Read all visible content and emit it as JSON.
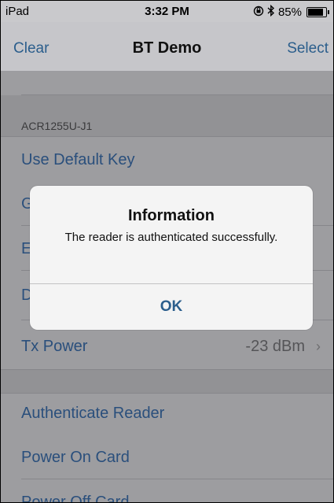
{
  "status_bar": {
    "carrier": "iPad",
    "time": "3:32 PM",
    "battery_text": "85%",
    "battery_level": 0.85,
    "icons": [
      "orientation-lock-icon",
      "bluetooth-icon",
      "battery-icon"
    ]
  },
  "nav": {
    "left": "Clear",
    "title": "BT Demo",
    "right": "Select"
  },
  "section": {
    "header": "ACR1255U-J1"
  },
  "rows": {
    "use_default_key": "Use Default Key",
    "hidden_1": "G",
    "hidden_2": "E",
    "hidden_3": "D",
    "tx_power": "Tx Power",
    "tx_power_value": "-23 dBm",
    "authenticate_reader": "Authenticate Reader",
    "power_on_card": "Power On Card",
    "power_off_card": "Power Off Card"
  },
  "alert": {
    "title": "Information",
    "message": "The reader is authenticated successfully.",
    "button": "OK"
  },
  "colors": {
    "tint": "#2b5e8c",
    "dimmed_background": "#9d9da0",
    "alert_background": "#f4f4f4"
  }
}
